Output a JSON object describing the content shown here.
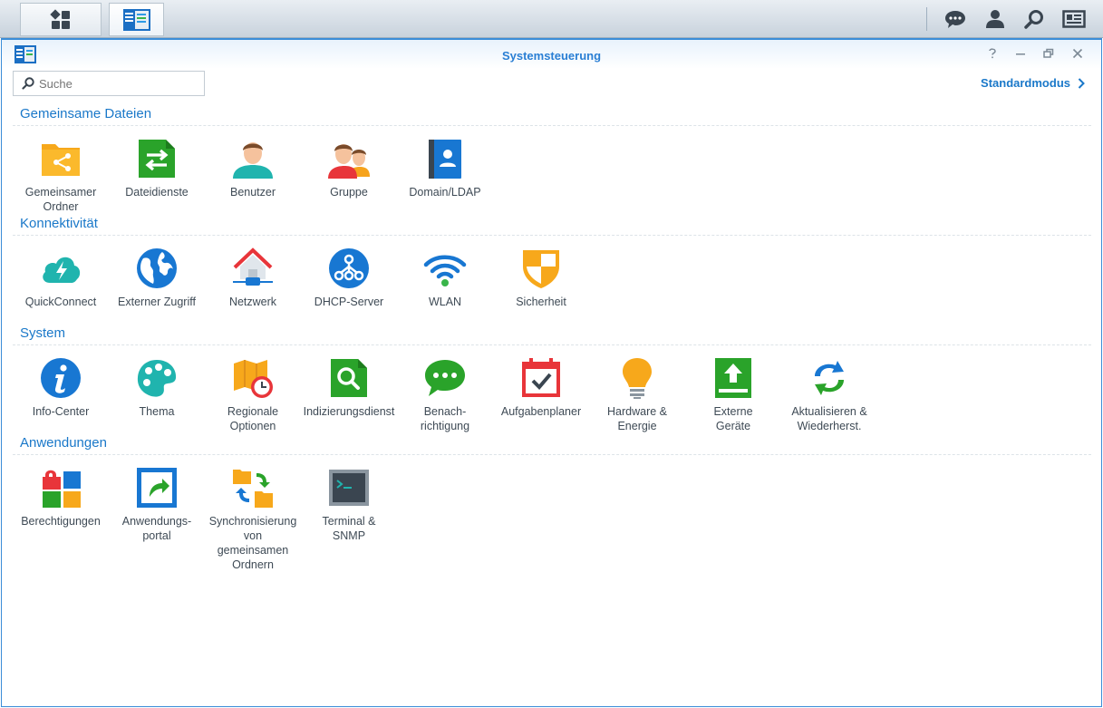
{
  "taskbar": {
    "main_menu_icon": "grid-icon",
    "active_app_icon": "control-panel-icon",
    "tray": [
      "chat-icon",
      "user-icon",
      "search-icon",
      "widgets-icon"
    ]
  },
  "window": {
    "title": "Systemsteuerung",
    "controls": [
      "help-icon",
      "minimize-icon",
      "restore-icon",
      "close-icon"
    ],
    "search_placeholder": "Suche",
    "mode_label": "Standardmodus"
  },
  "sections": [
    {
      "title": "Gemeinsame Dateien",
      "items": [
        {
          "label": "Gemeinsamer\nOrdner",
          "icon": "shared-folder-icon"
        },
        {
          "label": "Dateidienste",
          "icon": "file-services-icon"
        },
        {
          "label": "Benutzer",
          "icon": "user-icon"
        },
        {
          "label": "Gruppe",
          "icon": "group-icon"
        },
        {
          "label": "Domain/LDAP",
          "icon": "domain-ldap-icon"
        }
      ]
    },
    {
      "title": "Konnektivität",
      "items": [
        {
          "label": "QuickConnect",
          "icon": "quickconnect-icon"
        },
        {
          "label": "Externer Zugriff",
          "icon": "external-access-icon"
        },
        {
          "label": "Netzwerk",
          "icon": "network-icon"
        },
        {
          "label": "DHCP-Server",
          "icon": "dhcp-server-icon"
        },
        {
          "label": "WLAN",
          "icon": "wlan-icon"
        },
        {
          "label": "Sicherheit",
          "icon": "security-icon"
        }
      ]
    },
    {
      "title": "System",
      "items": [
        {
          "label": "Info-Center",
          "icon": "info-center-icon"
        },
        {
          "label": "Thema",
          "icon": "theme-icon"
        },
        {
          "label": "Regionale\nOptionen",
          "icon": "regional-options-icon"
        },
        {
          "label": "Indizierungsdienst",
          "icon": "indexing-service-icon"
        },
        {
          "label": "Benach-\nrichtigung",
          "icon": "notification-icon"
        },
        {
          "label": "Aufgabenplaner",
          "icon": "task-scheduler-icon"
        },
        {
          "label": "Hardware &\nEnergie",
          "icon": "hardware-power-icon"
        },
        {
          "label": "Externe\nGeräte",
          "icon": "external-devices-icon"
        },
        {
          "label": "Aktualisieren &\nWiederherst.",
          "icon": "update-restore-icon"
        }
      ]
    },
    {
      "title": "Anwendungen",
      "items": [
        {
          "label": "Berechtigungen",
          "icon": "privileges-icon"
        },
        {
          "label": "Anwendungs-\nportal",
          "icon": "application-portal-icon"
        },
        {
          "label": "Synchronisierung\nvon\ngemeinsamen\nOrdnern",
          "icon": "shared-folder-sync-icon"
        },
        {
          "label": "Terminal &\nSNMP",
          "icon": "terminal-snmp-icon"
        }
      ]
    }
  ]
}
